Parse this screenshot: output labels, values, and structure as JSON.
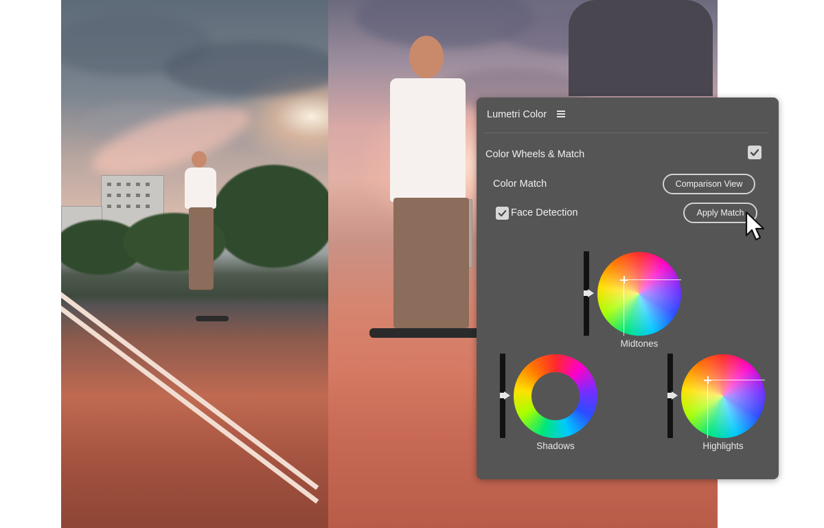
{
  "panel": {
    "title": "Lumetri Color",
    "menu_icon": "hamburger-menu-icon",
    "section_label": "Color Wheels & Match",
    "section_enabled": true,
    "color_match_label": "Color Match",
    "comparison_view_label": "Comparison View",
    "face_detection_label": "Face Detection",
    "face_detection_checked": true,
    "apply_match_label": "Apply Match",
    "wheels": {
      "midtones_label": "Midtones",
      "shadows_label": "Shadows",
      "highlights_label": "Highlights"
    }
  },
  "colors": {
    "panel_bg": "#555555",
    "slider_track": "#121212",
    "button_border": "#d2d2d2"
  }
}
